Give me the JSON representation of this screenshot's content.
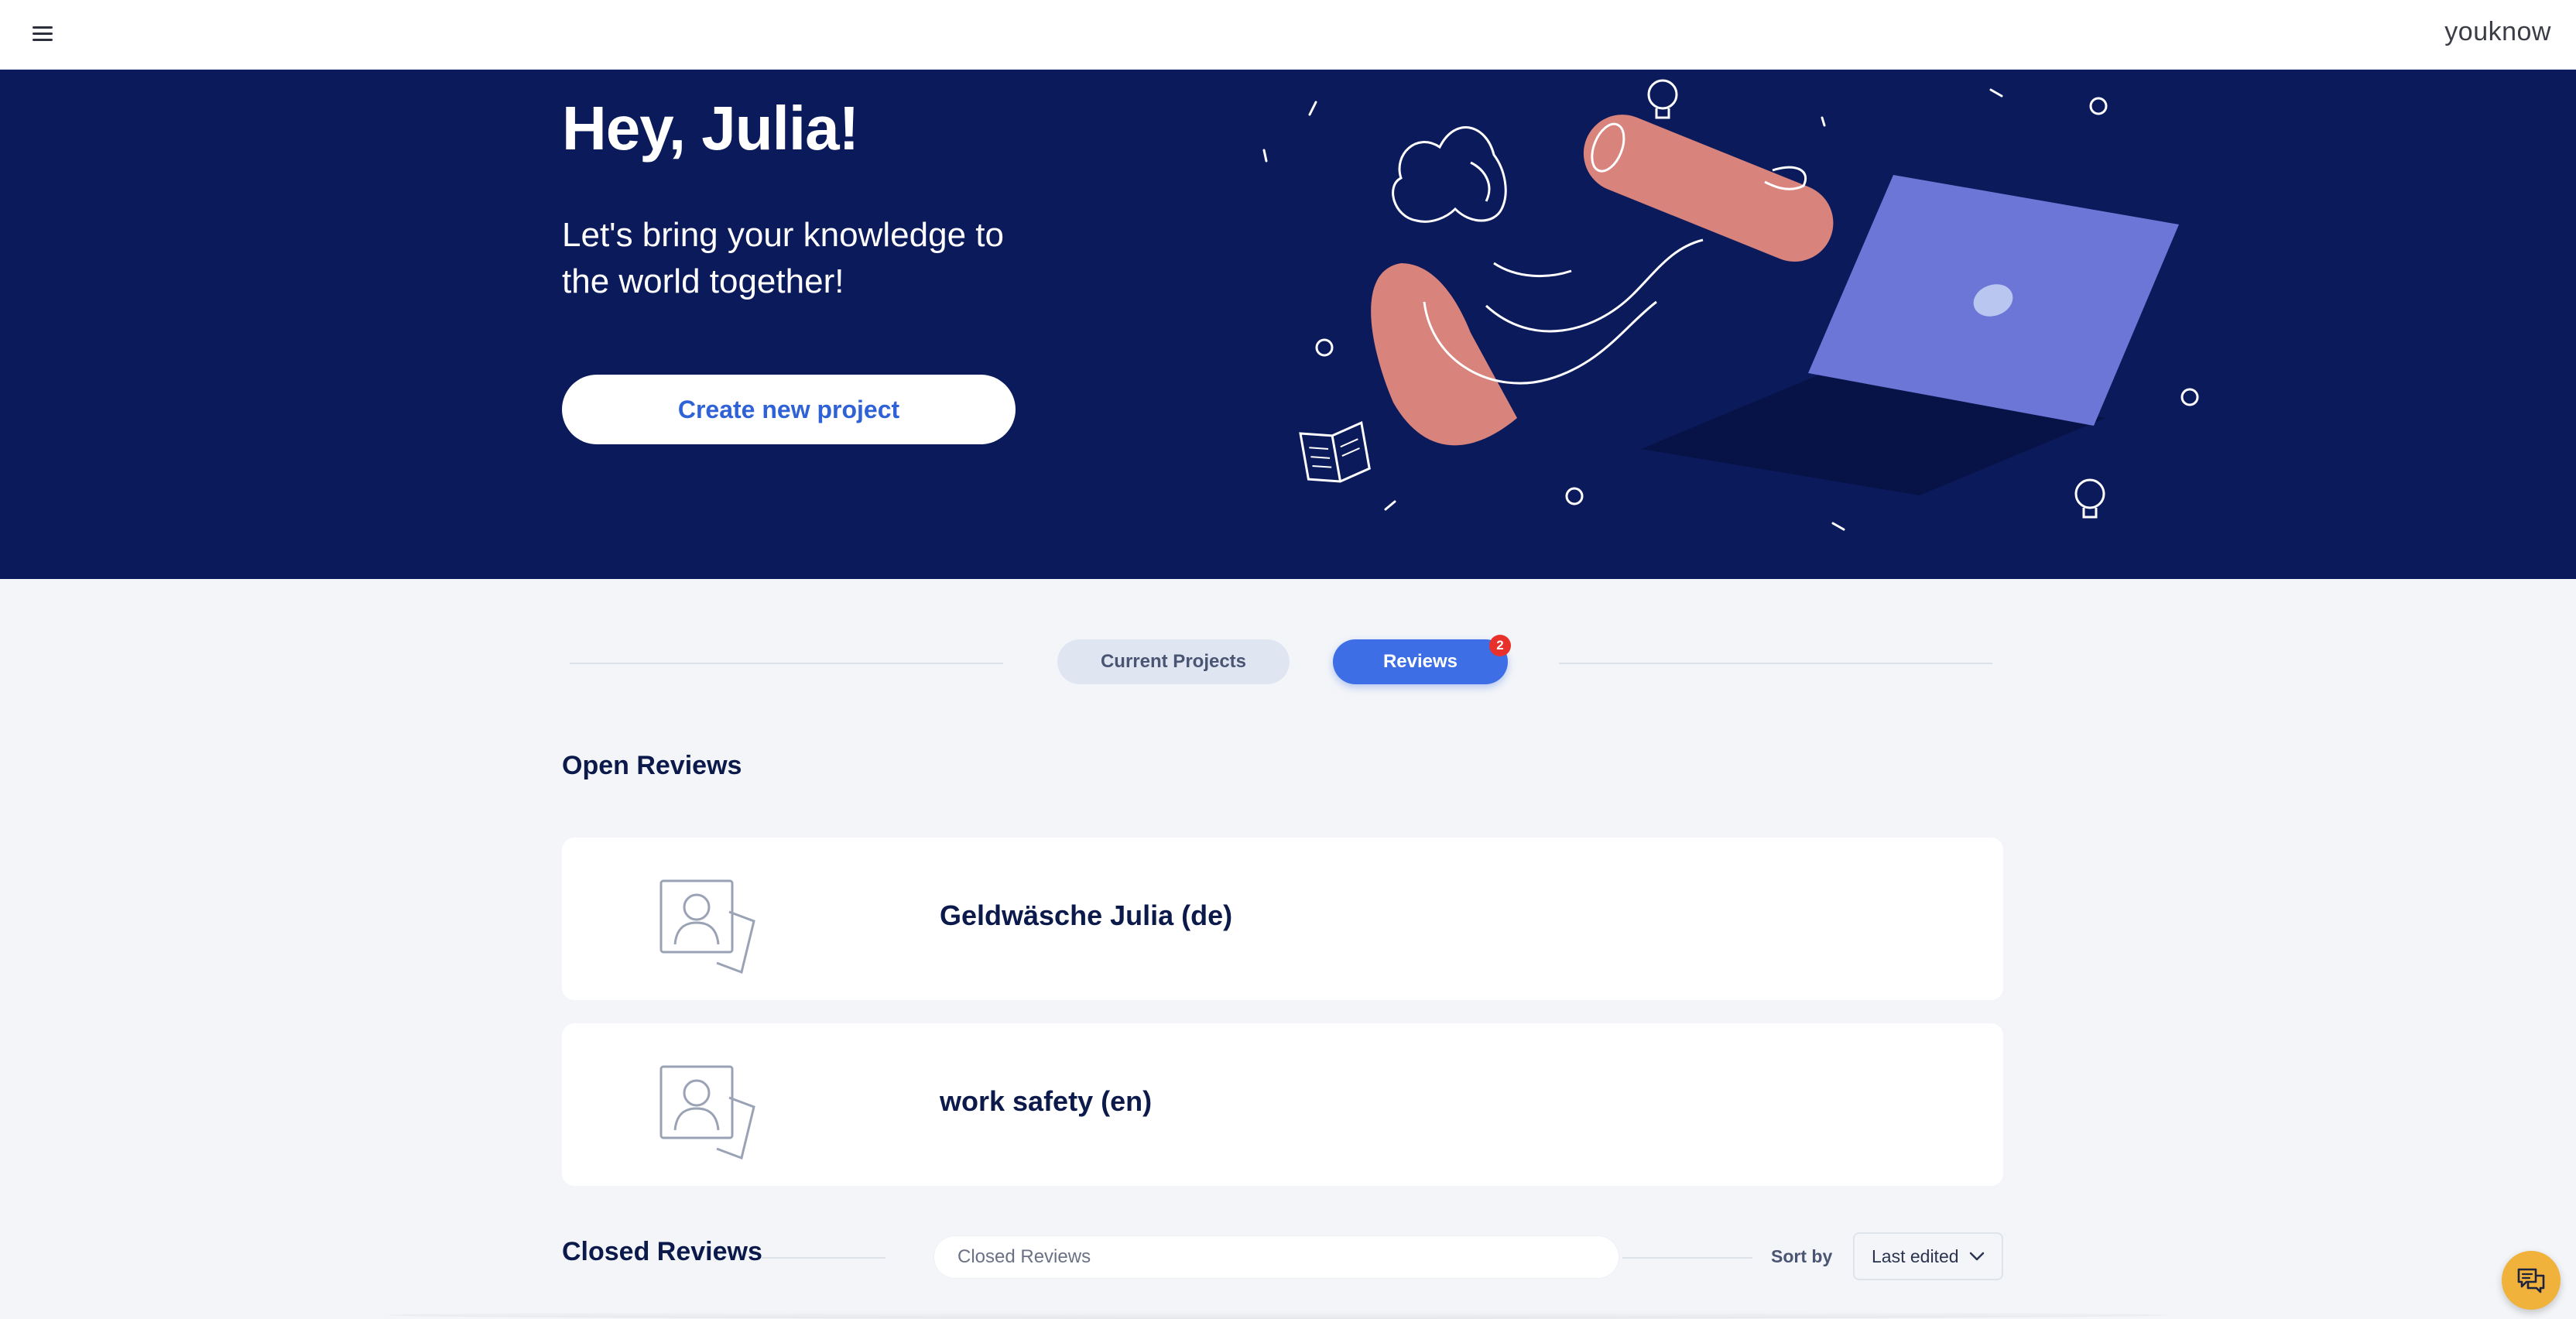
{
  "app": {
    "logo": "youknow",
    "menu_icon": "hamburger-menu-icon"
  },
  "hero": {
    "greeting": "Hey, Julia!",
    "subtitle": "Let's bring your knowledge to the world together!",
    "cta_label": "Create new project",
    "colors": {
      "background": "#0b1a5b",
      "accent": "#2f62d7"
    }
  },
  "tabs": {
    "current_label": "Current Projects",
    "reviews_label": "Reviews",
    "reviews_badge": "2",
    "active": "Reviews"
  },
  "open_reviews": {
    "title": "Open Reviews",
    "items": [
      {
        "name": "Geldwäsche Julia (de)",
        "icon": "project-thumbnail-icon"
      },
      {
        "name": "work safety (en)",
        "icon": "project-thumbnail-icon"
      }
    ]
  },
  "closed_reviews": {
    "title": "Closed Reviews",
    "search_placeholder": "Closed Reviews",
    "sort_label": "Sort by",
    "sort_value": "Last edited"
  },
  "chat": {
    "icon": "chat-icon"
  }
}
